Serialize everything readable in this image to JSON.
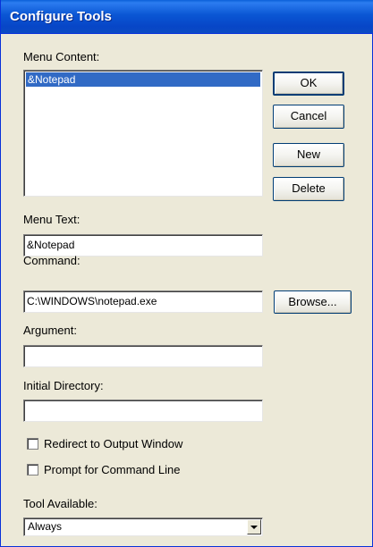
{
  "window": {
    "title": "Configure Tools"
  },
  "menu_content": {
    "label": "Menu Content:",
    "items": [
      "&Notepad"
    ],
    "selected_index": 0
  },
  "buttons": {
    "ok": "OK",
    "cancel": "Cancel",
    "new": "New",
    "delete": "Delete",
    "browse": "Browse..."
  },
  "fields": {
    "menu_text": {
      "label": "Menu Text:",
      "value": "&Notepad"
    },
    "command": {
      "label": "Command:",
      "value": "C:\\WINDOWS\\notepad.exe"
    },
    "argument": {
      "label": "Argument:",
      "value": ""
    },
    "initial_directory": {
      "label": "Initial Directory:",
      "value": ""
    }
  },
  "checkboxes": {
    "redirect": {
      "label": "Redirect to Output Window",
      "checked": false
    },
    "prompt": {
      "label": "Prompt for Command Line",
      "checked": false
    }
  },
  "tool_available": {
    "label": "Tool Available:",
    "selected": "Always"
  },
  "icons": {
    "dropdown": "chevron-down-icon"
  }
}
